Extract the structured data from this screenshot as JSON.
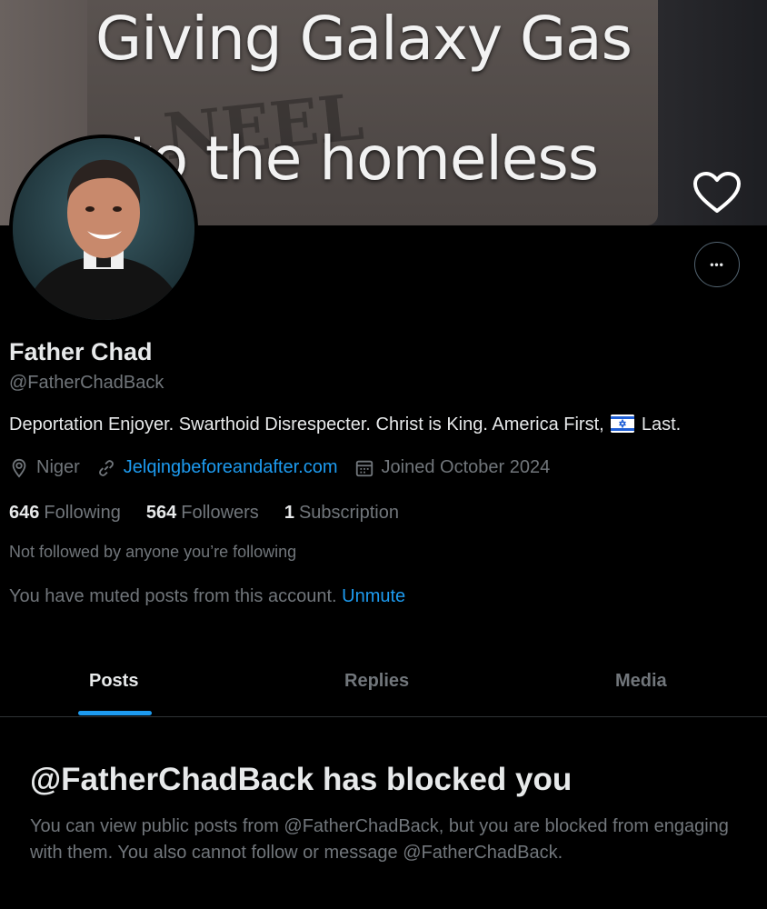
{
  "banner": {
    "caption_line1": "Giving Galaxy Gas",
    "caption_line2": "to the homeless"
  },
  "icons": {
    "heart": "heart-icon",
    "more": "more-horizontal-icon",
    "location": "location-pin-icon",
    "link": "link-icon",
    "calendar": "calendar-icon",
    "flag": "israel-flag-icon"
  },
  "profile": {
    "name": "Father Chad",
    "handle": "@FatherChadBack",
    "bio_before_flag": "Deportation Enjoyer. Swarthoid Disrespecter. Christ is King. America First,",
    "bio_after_flag": "Last.",
    "location": "Niger",
    "website": "Jelqingbeforeandafter.com",
    "joined": "Joined October 2024",
    "more_button": "•••"
  },
  "stats": {
    "following_count": "646",
    "following_label": "Following",
    "followers_count": "564",
    "followers_label": "Followers",
    "subscriptions_count": "1",
    "subscriptions_label": "Subscription"
  },
  "notices": {
    "not_followed": "Not followed by anyone you’re following",
    "muted_text": "You have muted posts from this account.",
    "unmute_label": "Unmute"
  },
  "tabs": [
    {
      "label": "Posts",
      "active": true
    },
    {
      "label": "Replies",
      "active": false
    },
    {
      "label": "Media",
      "active": false
    }
  ],
  "blocked": {
    "title": "@FatherChadBack has blocked you",
    "description": "You can view public posts from @FatherChadBack, but you are blocked from engaging with them. You also cannot follow or message @FatherChadBack."
  },
  "colors": {
    "background": "#000000",
    "text_primary": "#e7e9ea",
    "text_secondary": "#71767b",
    "accent": "#1d9bf0",
    "divider": "#2f3336"
  }
}
